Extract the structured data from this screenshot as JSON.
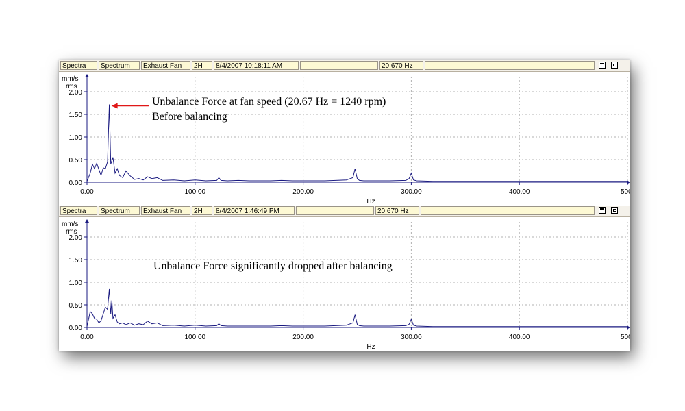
{
  "panels": [
    {
      "header": {
        "cells": [
          "Spectra",
          "Spectrum",
          "Exhaust Fan",
          "2H",
          "8/4/2007 10:18:11 AM",
          "",
          "20.670 Hz",
          ""
        ]
      },
      "annotation": {
        "line1": "Unbalance Force at fan speed (20.67 Hz = 1240 rpm)",
        "line2": "Before balancing"
      }
    },
    {
      "header": {
        "cells": [
          "Spectra",
          "Spectrum",
          "Exhaust Fan",
          "2H",
          "8/4/2007 1:46:49 PM",
          "",
          "20.670 Hz",
          ""
        ]
      },
      "annotation": {
        "line1": "Unbalance Force significantly dropped after balancing"
      }
    }
  ],
  "chart_data": [
    {
      "type": "line",
      "xlabel": "Hz",
      "ylabel": "mm/s rms",
      "xlim": [
        0,
        500
      ],
      "ylim": [
        0,
        2.0
      ],
      "xticks": [
        "0.00",
        "100.00",
        "200.00",
        "300.00",
        "400.00",
        "500"
      ],
      "yticks": [
        "0.00",
        "0.50",
        "1.00",
        "1.50",
        "2.00"
      ],
      "grid": true,
      "series": [
        {
          "color": "#1a1a80",
          "x": [
            0,
            3,
            5,
            7,
            9,
            11,
            13,
            15,
            17,
            19,
            20.67,
            22,
            24,
            26,
            28,
            30,
            33,
            36,
            40,
            44,
            48,
            52,
            56,
            60,
            65,
            70,
            80,
            90,
            100,
            110,
            120,
            122,
            124,
            130,
            140,
            150,
            160,
            170,
            180,
            190,
            200,
            210,
            220,
            230,
            240,
            246,
            248,
            250,
            252,
            256,
            265,
            280,
            295,
            298,
            300,
            302,
            305,
            320,
            350,
            400,
            450,
            500
          ],
          "y": [
            0.02,
            0.2,
            0.4,
            0.3,
            0.42,
            0.28,
            0.15,
            0.32,
            0.3,
            0.45,
            1.72,
            0.4,
            0.55,
            0.2,
            0.3,
            0.15,
            0.1,
            0.25,
            0.14,
            0.06,
            0.08,
            0.05,
            0.12,
            0.08,
            0.1,
            0.04,
            0.05,
            0.03,
            0.05,
            0.03,
            0.04,
            0.1,
            0.04,
            0.03,
            0.04,
            0.03,
            0.03,
            0.03,
            0.04,
            0.03,
            0.03,
            0.03,
            0.03,
            0.04,
            0.05,
            0.1,
            0.3,
            0.08,
            0.04,
            0.03,
            0.03,
            0.03,
            0.04,
            0.08,
            0.2,
            0.05,
            0.03,
            0.02,
            0.02,
            0.02,
            0.02,
            0.02
          ]
        }
      ]
    },
    {
      "type": "line",
      "xlabel": "Hz",
      "ylabel": "mm/s rms",
      "xlim": [
        0,
        500
      ],
      "ylim": [
        0,
        2.0
      ],
      "xticks": [
        "0.00",
        "100.00",
        "200.00",
        "300.00",
        "400.00",
        "500"
      ],
      "yticks": [
        "0.00",
        "0.50",
        "1.00",
        "1.50",
        "2.00"
      ],
      "grid": true,
      "series": [
        {
          "color": "#1a1a80",
          "x": [
            0,
            3,
            5,
            7,
            9,
            11,
            13,
            15,
            17,
            19,
            20.67,
            22,
            23,
            24,
            26,
            28,
            30,
            33,
            36,
            40,
            44,
            48,
            52,
            56,
            60,
            65,
            70,
            80,
            90,
            100,
            110,
            120,
            122,
            124,
            130,
            140,
            150,
            160,
            170,
            180,
            190,
            200,
            210,
            220,
            230,
            240,
            246,
            248,
            250,
            252,
            256,
            265,
            280,
            295,
            298,
            300,
            302,
            305,
            320,
            350,
            400,
            450,
            500
          ],
          "y": [
            0.02,
            0.35,
            0.3,
            0.2,
            0.18,
            0.1,
            0.15,
            0.3,
            0.45,
            0.4,
            0.85,
            0.3,
            0.6,
            0.2,
            0.28,
            0.12,
            0.08,
            0.1,
            0.06,
            0.1,
            0.05,
            0.08,
            0.06,
            0.14,
            0.08,
            0.1,
            0.04,
            0.05,
            0.03,
            0.05,
            0.03,
            0.04,
            0.08,
            0.04,
            0.03,
            0.03,
            0.03,
            0.03,
            0.03,
            0.04,
            0.03,
            0.03,
            0.03,
            0.03,
            0.04,
            0.05,
            0.1,
            0.28,
            0.07,
            0.04,
            0.03,
            0.03,
            0.03,
            0.04,
            0.07,
            0.18,
            0.05,
            0.03,
            0.02,
            0.02,
            0.02,
            0.02,
            0.02
          ]
        }
      ]
    }
  ]
}
